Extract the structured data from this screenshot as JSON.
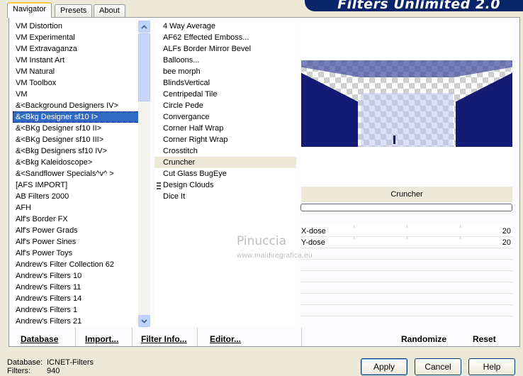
{
  "tabs": [
    {
      "label": "Navigator",
      "active": true
    },
    {
      "label": "Presets",
      "active": false
    },
    {
      "label": "About",
      "active": false
    }
  ],
  "banner_title": "Filters Unlimited 2.0",
  "categories": [
    "VM Distortion",
    "VM Experimental",
    "VM Extravaganza",
    "VM Instant Art",
    "VM Natural",
    "VM Toolbox",
    "VM",
    "&<Background Designers IV>",
    "&<Bkg Designer sf10 I>",
    "&<BKg Designer sf10 II>",
    "&<BKg Designer sf10 III>",
    "&<Bkg Designers sf10 IV>",
    "&<Bkg Kaleidoscope>",
    "&<Sandflower Specials^v^ >",
    "[AFS IMPORT]",
    "AB Filters 2000",
    "AFH",
    "Alf's Border FX",
    "Alf's Power Grads",
    "Alf's Power Sines",
    "Alf's Power Toys",
    "Andrew's Filter Collection 62",
    "Andrew's Filters 10",
    "Andrew's Filters 11",
    "Andrew's Filters 14",
    "Andrew's Filters 1",
    "Andrew's Filters 21"
  ],
  "selected_category": "&<Bkg Designer sf10 I>",
  "filters": [
    "4 Way Average",
    "AF62 Effected Emboss...",
    "ALFs Border Mirror Bevel",
    "Balloons...",
    "bee morph",
    "BlindsVertical",
    "Centripedal Tile",
    "Circle Pede",
    "Convergance",
    "Corner Half Wrap",
    "Corner Right Wrap",
    "Crosstitch",
    "Cruncher",
    "Cut Glass  BugEye",
    "Design Clouds",
    "Dice It"
  ],
  "selected_filter": "Cruncher",
  "filter_name": "Cruncher",
  "progress_fraction": 0,
  "params": [
    {
      "label": "X-dose",
      "value": "20"
    },
    {
      "label": "Y-dose",
      "value": "20"
    }
  ],
  "toolbar": {
    "database": "Database",
    "import": "Import...",
    "filter_info": "Filter Info...",
    "editor": "Editor...",
    "randomize": "Randomize",
    "reset": "Reset"
  },
  "status": {
    "database_label": "Database:",
    "database_value": "ICNET-Filters",
    "filters_label": "Filters:",
    "filters_value": "940"
  },
  "buttons": {
    "apply": "Apply",
    "cancel": "Cancel",
    "help": "Help"
  },
  "watermark": {
    "line1": "Pinuccia",
    "line2": "www.maidiregrafica.eu"
  }
}
